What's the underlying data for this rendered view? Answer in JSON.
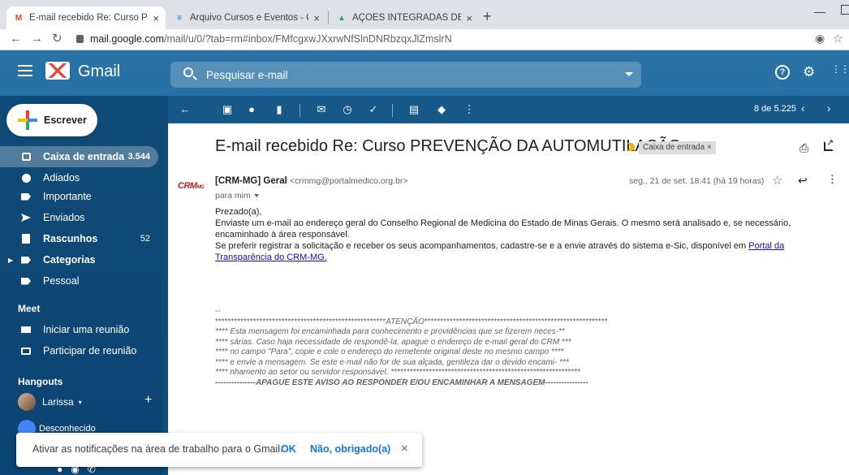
{
  "browser": {
    "tabs": [
      {
        "title": "E-mail recebido Re: Curso PREVE",
        "favicon": "M",
        "active": true
      },
      {
        "title": "Arquivo Cursos e Eventos - Core",
        "favicon": "≡",
        "active": false
      },
      {
        "title": "AÇÕES INTEGRADAS DE EDUCOI",
        "favicon": "▲",
        "active": false
      }
    ],
    "close_glyph": "×",
    "new_tab_glyph": "+",
    "minimize_glyph": "—",
    "url_host": "mail.google.com",
    "url_path": "/mail/u/0/?tab=rm#inbox/FMfcgxwJXxrwNfSlnDNRbzqxJlZmslrN"
  },
  "gmail": {
    "app_name": "Gmail",
    "search_placeholder": "Pesquisar e-mail",
    "compose_label": "Escrever",
    "nav": [
      {
        "label": "Caixa de entrada",
        "count": "3.544",
        "selected": true,
        "bold": true,
        "icon": "inbox-icon"
      },
      {
        "label": "Adiados",
        "count": "",
        "icon": "clock-icon"
      },
      {
        "label": "Importante",
        "count": "",
        "icon": "important-icon"
      },
      {
        "label": "Enviados",
        "count": "",
        "icon": "send-icon"
      },
      {
        "label": "Rascunhos",
        "count": "52",
        "bold": true,
        "icon": "draft-icon"
      },
      {
        "label": "Categorias",
        "count": "",
        "bold": true,
        "icon": "label-icon"
      },
      {
        "label": "Pessoal",
        "count": "",
        "icon": "label-icon"
      }
    ],
    "meet_title": "Meet",
    "meet_items": [
      "Iniciar uma reunião",
      "Participar de reunião"
    ],
    "hangouts_title": "Hangouts",
    "hangouts_user": "Larissa",
    "hangouts_unknown": "Desconhecido",
    "pager": "8 de 5.225"
  },
  "message": {
    "subject": "E-mail recebido Re: Curso PREVENÇÃO DA AUTOMUTILAÇÃO",
    "label_chip": "Caixa de entrada ×",
    "sender_logo": "CRM",
    "sender_logo_sub": "MG",
    "sender_name": "[CRM-MG] Geral",
    "sender_email": "<crmmg@portalmedico.org.br>",
    "to": "para mim",
    "date": "seg., 21 de set. 18:41 (há 19 horas)",
    "greeting": "Prezado(a),",
    "paragraph1": "Enviaste um e-mail ao endereço geral do Conselho Regional de Medicina do Estado de Minas Gerais. O mesmo será analisado e, se necessário, encaminhado à área responsável.",
    "paragraph2_before_link": "Se preferir registrar a solicitação e receber os seus acompanhamentos, cadastre-se e a envie através do sistema e-Sic, disponível em ",
    "paragraph2_link": "Portal da Transparência do CRM-MG.",
    "signature": {
      "dash": "--",
      "line_attention_prefix": "******************************************************",
      "line_attention_word": "ATENÇÃO",
      "line_attention_suffix": "**********************************************************",
      "lines": [
        "**** Esta mensagem foi encaminhada para conhecimento e providências que se fizerem neces-**",
        "**** sárias. Caso haja necessidade de respondê-la, apague o endereço de e-mail geral do CRM ***",
        "**** no campo \"Para\", copie e cole o endereço do remetente original deste no mesmo campo ****",
        "**** e envie a mensagem. Se este e-mail não for de sua alçada, gentileza dar o devido encami- ***",
        "**** nhamento ao setor ou servidor responsável. ************************************************************"
      ],
      "footer": "---------------APAGUE ESTE AVISO AO RESPONDER E/OU ENCAMINHAR A MENSAGEM----------------"
    }
  },
  "notification": {
    "text": "Ativar as notificações na área de trabalho para o Gmail.",
    "ok": "OK",
    "no": "Não, obrigado(a)",
    "close": "×"
  }
}
